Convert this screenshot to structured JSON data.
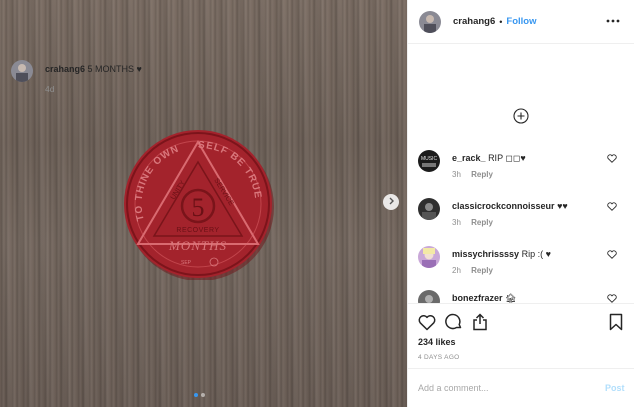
{
  "post": {
    "username": "crahang6",
    "separator": "•",
    "follow_label": "Follow",
    "caption_text": "5 MONTHS ♥",
    "caption_time": "4d",
    "likes": "234 likes",
    "date": "4 DAYS AGO",
    "add_comment_placeholder": "Add a comment...",
    "post_label": "Post"
  },
  "coin": {
    "outer_text_left": "TO THINE OWN",
    "outer_text_right": "SELF BE TRUE",
    "inner_left": "UNITY",
    "inner_right": "SERVICE",
    "number": "5",
    "recovery": "RECOVERY",
    "months": "MONTHS",
    "small_left": "SEP",
    "color": "#a3232c"
  },
  "comments": [
    {
      "username": "e_rack_",
      "text": "RIP ◻◻♥",
      "time": "3h",
      "reply": "Reply"
    },
    {
      "username": "classicrockconnoisseur",
      "text": "♥♥",
      "time": "3h",
      "reply": "Reply"
    },
    {
      "username": "missychrissssy",
      "text": "Rip :( ♥",
      "time": "2h",
      "reply": "Reply"
    },
    {
      "username": "bonezfrazer",
      "text": "🏚",
      "time": "",
      "reply": ""
    }
  ],
  "icons": {
    "more": "more-options-icon",
    "next": "chevron-right-icon",
    "like": "heart-icon",
    "comment": "comment-icon",
    "share": "share-icon",
    "save": "bookmark-icon",
    "load_more": "plus-circle-icon"
  },
  "colors": {
    "accent": "#3897f0",
    "border": "#efefef",
    "muted": "#8e8e8e"
  }
}
